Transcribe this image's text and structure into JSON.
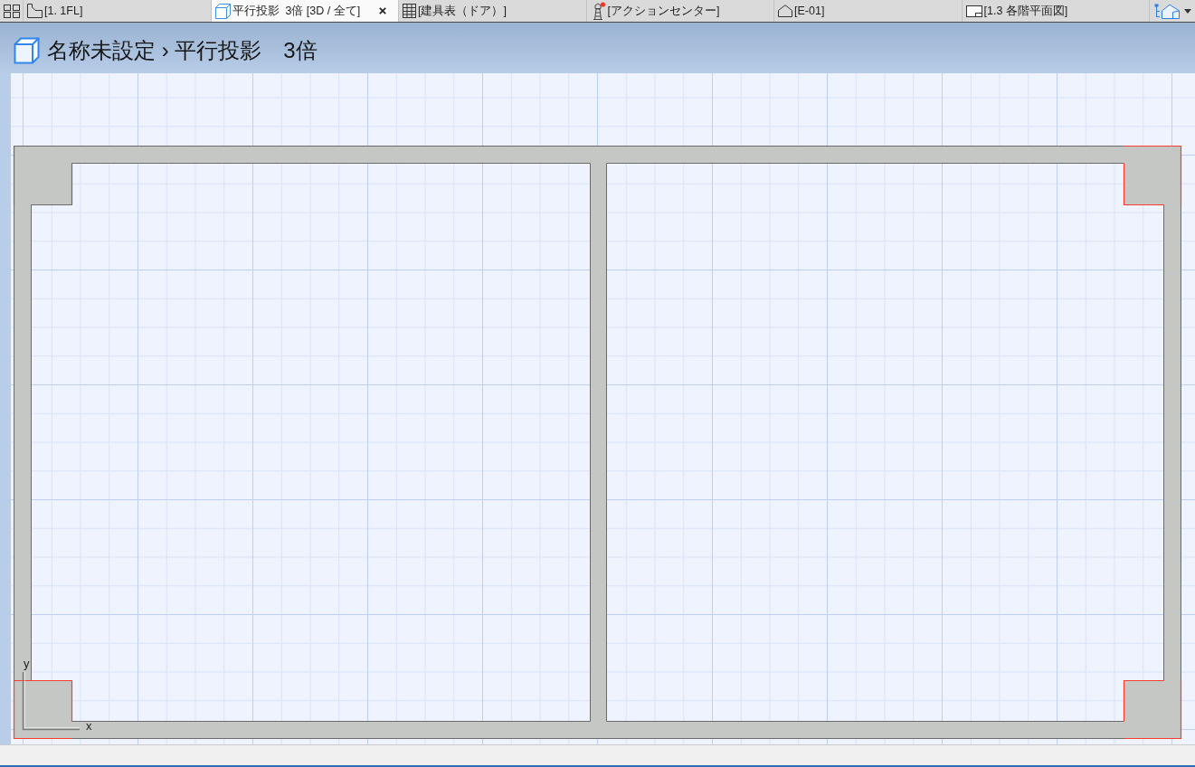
{
  "tab_bar": {
    "tabs": [
      {
        "kind": "plan",
        "label": "[1. 1FL]",
        "selected": false
      },
      {
        "kind": "model",
        "label": "平行投影  3倍 [3D / 全て]",
        "selected": true
      },
      {
        "kind": "schedule",
        "label": "[建具表（ドア）]",
        "selected": false
      },
      {
        "kind": "notice",
        "label": "[アクションセンター]",
        "selected": false
      },
      {
        "kind": "elevation",
        "label": "[E-01]",
        "selected": false
      },
      {
        "kind": "layout",
        "label": "[1.3 各階平面図]",
        "selected": false
      }
    ]
  },
  "view_header": {
    "title": "名称未設定 › 平行投影　3倍"
  },
  "plan": {
    "columns": [
      {
        "highlighted": false
      },
      {
        "highlighted": true
      },
      {
        "highlighted": true
      },
      {
        "highlighted": true
      }
    ],
    "axes": {
      "x_label": "x",
      "y_label": "y"
    }
  }
}
